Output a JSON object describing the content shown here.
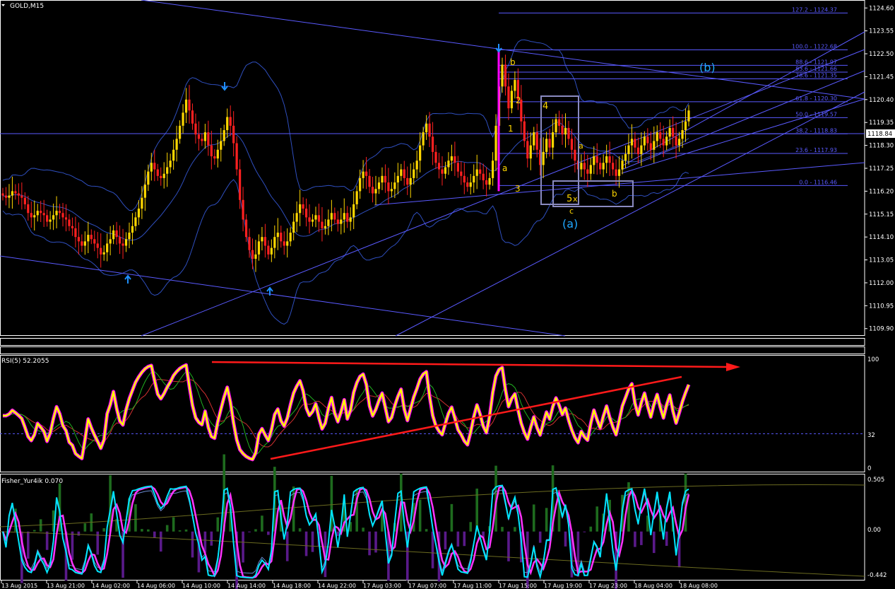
{
  "window_title": "GOLD,M15",
  "colors": {
    "bg": "#000000",
    "frame": "#ffffff",
    "bull_candle": "#ffd700",
    "bear_candle": "#ff2020",
    "channel": "#5a5aff",
    "bollinger": "#2f4fbf",
    "fib_line": "#5a5aff",
    "wave_box": "#8a8ac0",
    "wave_label_yellow": "#ffd700",
    "wave_label_cyan": "#20a8ff",
    "arrow_blue": "#1e90ff",
    "spike_magenta": "#ff00ff",
    "rsi_line": "#ffff00",
    "rsi_glow": "#ff00ff",
    "rsi_trend": "#ff1a1a",
    "hist_pos": "#1e6b1e",
    "hist_neg": "#5a1a8a",
    "fisher_cyan": "#00e5ff",
    "fisher_magenta": "#ff33ff"
  },
  "price_axis": {
    "ticks": [
      "1124.60",
      "1123.55",
      "1122.50",
      "1121.45",
      "1120.40",
      "1119.35",
      "1118.30",
      "1117.25",
      "1116.20",
      "1115.15",
      "1114.10",
      "1113.05",
      "1112.00",
      "1110.95",
      "1109.90"
    ],
    "current_price": "1118.84"
  },
  "time_axis": {
    "ticks": [
      "13 Aug 2015",
      "13 Aug 21:00",
      "14 Aug 02:00",
      "14 Aug 06:00",
      "14 Aug 10:00",
      "14 Aug 14:00",
      "14 Aug 18:00",
      "14 Aug 22:00",
      "17 Aug 03:00",
      "17 Aug 07:00",
      "17 Aug 11:00",
      "17 Aug 15:00",
      "17 Aug 19:00",
      "17 Aug 23:00",
      "18 Aug 04:00",
      "18 Aug 08:00"
    ]
  },
  "fib_levels": [
    {
      "label": "127.2 - 1124.37",
      "price": 1124.37
    },
    {
      "label": "100.0 - 1122.68",
      "price": 1122.68
    },
    {
      "label": "88.6 - 1121.97",
      "price": 1121.97
    },
    {
      "label": "83.6 - 1121.66",
      "price": 1121.66
    },
    {
      "label": "78.6 - 1121.35",
      "price": 1121.35
    },
    {
      "label": "61.8 - 1120.30",
      "price": 1120.3
    },
    {
      "label": "50.0 - 1119.57",
      "price": 1119.57
    },
    {
      "label": "38.2 - 1118.83",
      "price": 1118.83
    },
    {
      "label": "23.6 - 1117.93",
      "price": 1117.93
    },
    {
      "label": "0.0 - 1116.46",
      "price": 1116.46
    }
  ],
  "wave_labels": {
    "b_top": "b",
    "two": "2",
    "one": "1",
    "a_low": "a",
    "three": "3",
    "four": "4",
    "a_mid": "a",
    "five": "5",
    "x": "x",
    "c": "c",
    "b_box": "b",
    "wave_a": "(a)",
    "wave_b": "(b)"
  },
  "rsi": {
    "title": "RSI(5) 52.2055",
    "ticks": [
      "100",
      "32",
      "0"
    ]
  },
  "fisher": {
    "title": "Fisher_Yur4ik 0.070",
    "ticks": [
      "0.505",
      "0.00",
      "-0.442"
    ]
  },
  "chart_data": [
    {
      "type": "candlestick",
      "title": "GOLD,M15",
      "ylim": [
        1109.6,
        1124.9
      ],
      "series": [
        {
          "name": "GOLD,M15",
          "close": [
            1116.0,
            1115.9,
            1116.0,
            1116.2,
            1116.1,
            1116.0,
            1115.9,
            1115.6,
            1115.2,
            1115.0,
            1115.1,
            1115.3,
            1115.2,
            1115.1,
            1114.8,
            1114.9,
            1115.1,
            1115.3,
            1115.2,
            1115.0,
            1114.9,
            1114.6,
            1114.5,
            1114.1,
            1113.9,
            1113.7,
            1113.9,
            1114.2,
            1114.0,
            1113.8,
            1113.6,
            1113.3,
            1113.4,
            1113.8,
            1114.0,
            1114.4,
            1114.1,
            1113.8,
            1113.7,
            1114.0,
            1114.3,
            1114.6,
            1115.0,
            1115.4,
            1115.9,
            1116.5,
            1117.1,
            1117.5,
            1117.2,
            1116.9,
            1116.8,
            1117.0,
            1117.3,
            1117.6,
            1118.1,
            1118.6,
            1119.2,
            1119.8,
            1120.4,
            1119.9,
            1119.3,
            1118.8,
            1118.6,
            1118.5,
            1118.9,
            1118.3,
            1117.8,
            1117.7,
            1118.1,
            1118.5,
            1119.0,
            1119.6,
            1119.2,
            1118.4,
            1117.2,
            1115.8,
            1114.9,
            1114.1,
            1113.5,
            1113.1,
            1113.3,
            1113.9,
            1114.1,
            1113.7,
            1113.3,
            1113.6,
            1114.1,
            1114.3,
            1113.9,
            1113.7,
            1113.9,
            1114.3,
            1114.8,
            1115.2,
            1115.6,
            1115.4,
            1115.0,
            1114.8,
            1114.9,
            1115.1,
            1114.8,
            1114.5,
            1114.6,
            1114.9,
            1115.2,
            1114.9,
            1114.7,
            1114.9,
            1115.2,
            1114.8,
            1115.0,
            1115.6,
            1116.2,
            1116.8,
            1117.1,
            1116.9,
            1116.4,
            1116.1,
            1116.3,
            1116.6,
            1116.9,
            1116.6,
            1116.2,
            1116.3,
            1116.6,
            1116.9,
            1117.2,
            1116.8,
            1116.5,
            1116.8,
            1117.2,
            1117.6,
            1118.3,
            1118.9,
            1119.3,
            1118.7,
            1118.0,
            1117.5,
            1117.2,
            1117.0,
            1117.3,
            1117.6,
            1117.8,
            1117.5,
            1117.1,
            1116.9,
            1116.6,
            1116.4,
            1116.6,
            1116.9,
            1117.2,
            1117.0,
            1116.7,
            1116.5,
            1116.8,
            1117.6,
            1119.2,
            1121.0,
            1122.0,
            1121.0,
            1120.0,
            1120.8,
            1121.3,
            1120.4,
            1119.4,
            1118.5,
            1117.7,
            1118.3,
            1118.9,
            1118.1,
            1117.4,
            1118.0,
            1118.6,
            1118.2,
            1118.9,
            1119.5,
            1119.2,
            1118.8,
            1119.1,
            1118.6,
            1118.1,
            1117.6,
            1117.2,
            1117.5,
            1117.2,
            1117.0,
            1117.4,
            1117.8,
            1117.5,
            1117.2,
            1117.5,
            1117.8,
            1117.5,
            1117.2,
            1116.9,
            1117.2,
            1117.6,
            1117.9,
            1118.3,
            1118.6,
            1118.2,
            1117.9,
            1118.3,
            1118.7,
            1118.4,
            1118.1,
            1118.5,
            1118.9,
            1118.6,
            1118.3,
            1118.7,
            1119.1,
            1118.7,
            1118.3,
            1118.6,
            1119.0,
            1119.4,
            1119.9
          ]
        }
      ]
    },
    {
      "type": "line",
      "title": "RSI(5) 52.2055",
      "ylim": [
        0,
        100
      ],
      "series": [
        {
          "name": "RSI(5)"
        }
      ]
    },
    {
      "type": "bar",
      "title": "Fisher_Yur4ik 0.070",
      "ylim": [
        -0.442,
        0.505
      ],
      "series": [
        {
          "name": "Fisher_Yur4ik"
        }
      ]
    }
  ]
}
